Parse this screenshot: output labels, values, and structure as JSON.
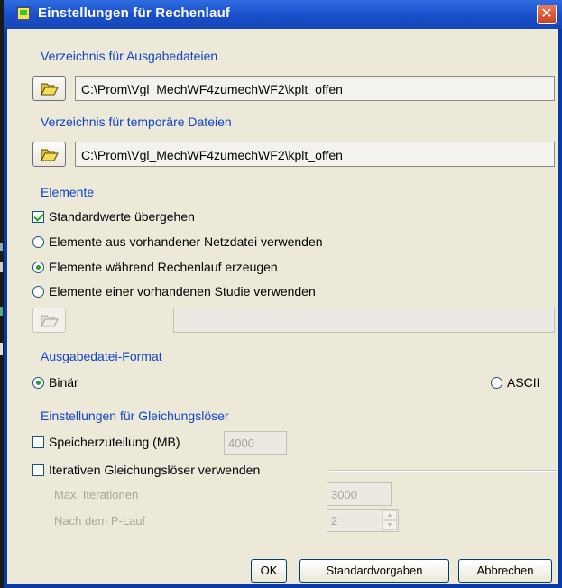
{
  "window": {
    "title": "Einstellungen für Rechenlauf",
    "title_icon": "app-window-icon",
    "close_glyph": "✕"
  },
  "output_dir": {
    "title": "Verzeichnis für Ausgabedateien",
    "path": "C:\\Prom\\Vgl_MechWF4zumechWF2\\kplt_offen",
    "icon": "folder-open-icon"
  },
  "temp_dir": {
    "title": "Verzeichnis für temporäre Dateien",
    "path": "C:\\Prom\\Vgl_MechWF4zumechWF2\\kplt_offen",
    "icon": "folder-open-icon"
  },
  "elements": {
    "title": "Elemente",
    "override_defaults": {
      "label": "Standardwerte übergehen",
      "checked": true
    },
    "options": [
      {
        "label": "Elemente aus vorhandener Netzdatei verwenden",
        "selected": false
      },
      {
        "label": "Elemente während Rechenlauf erzeugen",
        "selected": true
      },
      {
        "label": "Elemente einer vorhandenen Studie verwenden",
        "selected": false
      }
    ],
    "study_path": ""
  },
  "output_format": {
    "title": "Ausgabedatei-Format",
    "binary_label": "Binär",
    "binary_selected": true,
    "ascii_label": "ASCII",
    "ascii_selected": false
  },
  "solver": {
    "title": "Einstellungen für Gleichungslöser",
    "memory_label": "Speicherzuteilung (MB)",
    "memory_checked": false,
    "memory_value": "4000",
    "iterative_label": "Iterativen Gleichungslöser verwenden",
    "iterative_checked": false,
    "max_iter_label": "Max. Iterationen",
    "max_iter_value": "3000",
    "after_p_label": "Nach dem P-Lauf",
    "after_p_value": "2"
  },
  "buttons": {
    "ok": "OK",
    "defaults": "Standardvorgaben",
    "cancel": "Abbrechen"
  },
  "colors": {
    "group_title": "#1245c8",
    "titlebar": "#1a4fcc",
    "dialog_bg": "#ece9d8",
    "check_mark": "#21a121"
  }
}
